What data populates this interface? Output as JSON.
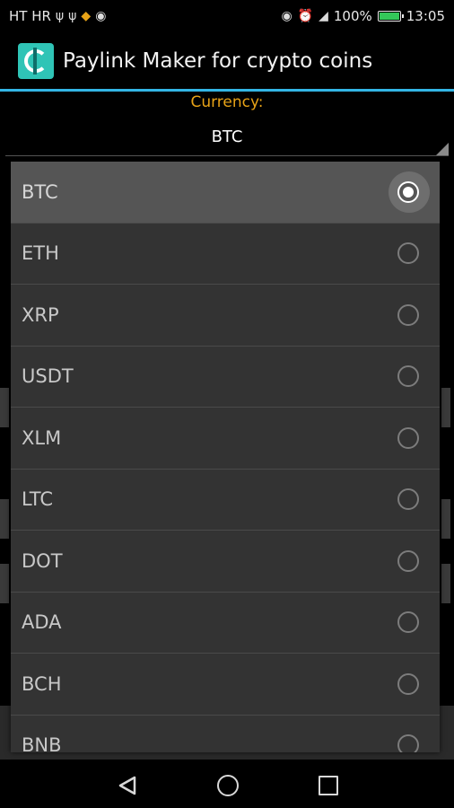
{
  "status_bar": {
    "carrier": "HT HR",
    "glyphs_left": [
      "usb-icon",
      "usb-icon",
      "crypto-notification-icon",
      "hotspot-icon"
    ],
    "glyphs_right": [
      "nfc-icon",
      "alarm-icon",
      "signal-icon"
    ],
    "battery_text": "100%",
    "battery_level": 1.0,
    "time": "13:05"
  },
  "action_bar": {
    "app_icon": "app-logo-icon",
    "title": "Paylink Maker for crypto coins"
  },
  "form": {
    "currency_label": "Currency:",
    "currency_value": "BTC"
  },
  "dropdown": {
    "options": [
      {
        "label": "BTC",
        "selected": true
      },
      {
        "label": "ETH",
        "selected": false
      },
      {
        "label": "XRP",
        "selected": false
      },
      {
        "label": "USDT",
        "selected": false
      },
      {
        "label": "XLM",
        "selected": false
      },
      {
        "label": "LTC",
        "selected": false
      },
      {
        "label": "DOT",
        "selected": false
      },
      {
        "label": "ADA",
        "selected": false
      },
      {
        "label": "BCH",
        "selected": false
      },
      {
        "label": "BNB",
        "selected": false
      }
    ]
  },
  "nav_bar": {
    "back": "back-icon",
    "home": "home-icon",
    "recents": "recents-icon"
  },
  "colors": {
    "accent_blue": "#33b5e5",
    "label_orange": "#e8a317",
    "dialog_bg": "#333333",
    "selected_row": "#555555"
  }
}
